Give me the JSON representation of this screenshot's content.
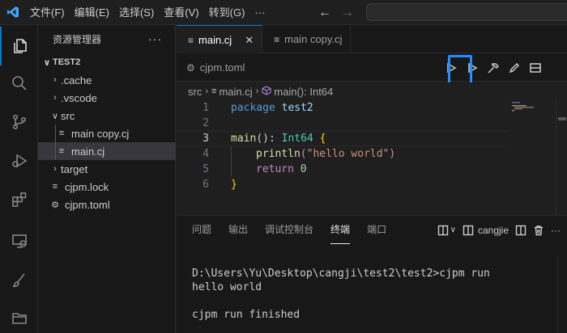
{
  "menu": [
    "文件(F)",
    "编辑(E)",
    "选择(S)",
    "查看(V)",
    "转到(G)",
    "···"
  ],
  "nav": {
    "back": "←",
    "forward": "→"
  },
  "sidebar": {
    "title": "资源管理器",
    "more": "···",
    "tree": [
      {
        "label": "TEST2",
        "chevron": "∨",
        "icon": ""
      },
      {
        "label": ".cache",
        "chevron": "›",
        "icon": ""
      },
      {
        "label": ".vscode",
        "chevron": "›",
        "icon": ""
      },
      {
        "label": "src",
        "chevron": "∨",
        "icon": ""
      },
      {
        "label": "main copy.cj",
        "chevron": "",
        "icon": "≡"
      },
      {
        "label": "main.cj",
        "chevron": "",
        "icon": "≡"
      },
      {
        "label": "target",
        "chevron": "›",
        "icon": ""
      },
      {
        "label": "cjpm.lock",
        "chevron": "",
        "icon": "≡"
      },
      {
        "label": "cjpm.toml",
        "chevron": "",
        "icon": "⚙"
      }
    ]
  },
  "tabs": [
    {
      "label": "main.cj",
      "icon": "≡",
      "close": "✕"
    },
    {
      "label": "main copy.cj",
      "icon": "≡"
    }
  ],
  "tab_row2": {
    "label": "cjpm.toml",
    "icon": "⚙"
  },
  "breadcrumb": {
    "folder": "src",
    "file": "main.cj",
    "symbol": "main(): Int64"
  },
  "code": {
    "line_numbers": [
      "1",
      "2",
      "3",
      "4",
      "5",
      "6"
    ],
    "l1_kw": "package",
    "l1_name": "test2",
    "l3_fn": "main",
    "l3_paren": "(): ",
    "l3_type": "Int64",
    "l3_brace": "{",
    "l4_fn": "println",
    "l4_open": "(",
    "l4_str": "\"hello world\"",
    "l4_close": ")",
    "l5_kw": "return",
    "l5_num": "0",
    "l6_brace": "}"
  },
  "panel": {
    "tabs": [
      "问题",
      "输出",
      "调试控制台",
      "终端",
      "端口"
    ],
    "terminal_name": "cangjie",
    "more": "···",
    "terminal_lines": [
      "D:\\Users\\Yu\\Desktop\\cangji\\test2\\test2>cjpm run",
      "hello world",
      "",
      "cjpm run finished"
    ]
  }
}
